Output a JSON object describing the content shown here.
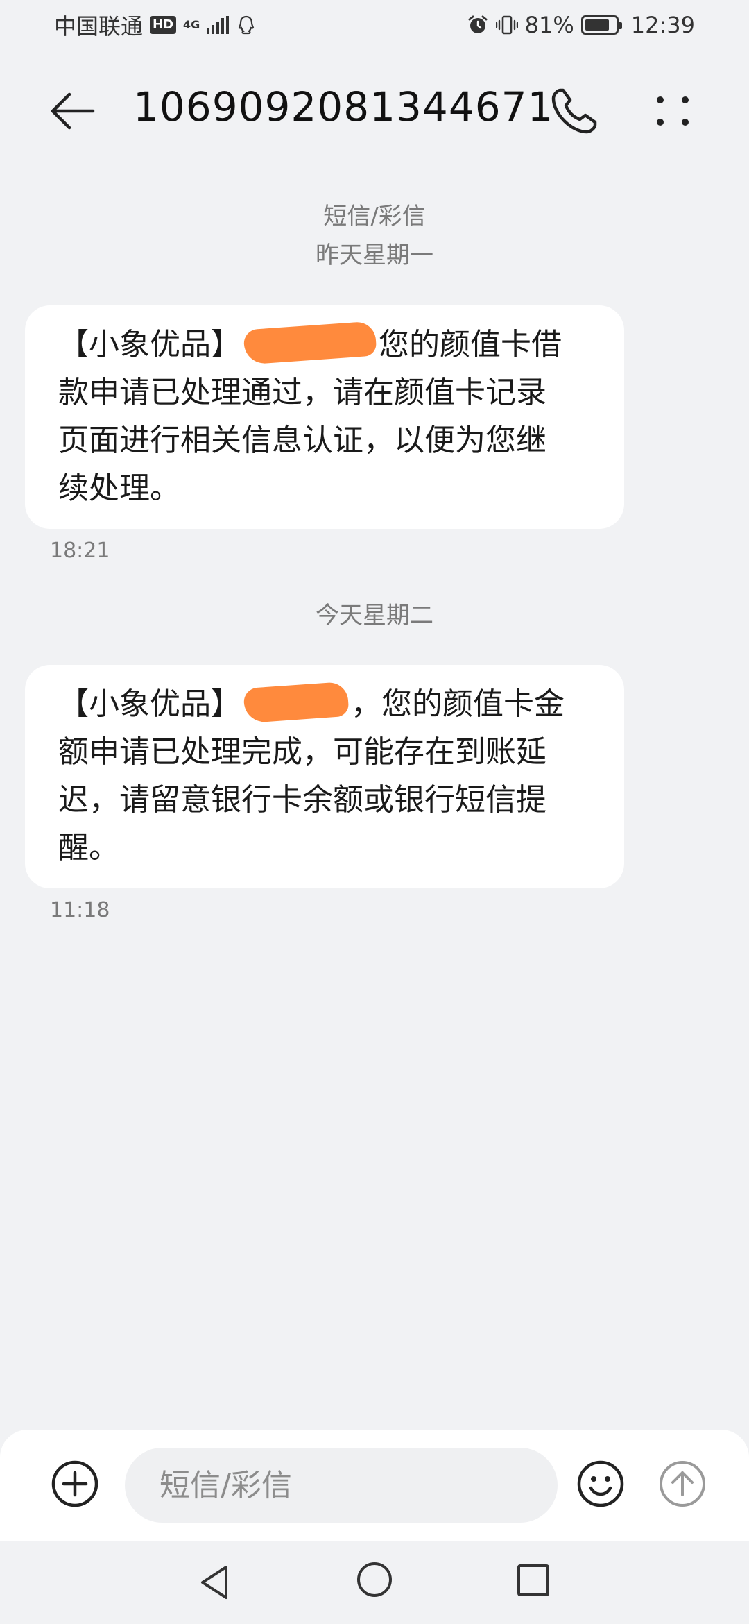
{
  "status_bar": {
    "carrier": "中国联通",
    "hd": "HD",
    "network": "4G",
    "battery_percent": "81%",
    "battery_level": 0.81,
    "time": "12:39"
  },
  "header": {
    "title": "1069092081344671"
  },
  "conversation": {
    "type_label": "短信/彩信",
    "groups": [
      {
        "date": "昨天星期一",
        "message": {
          "prefix": "【小象优品】",
          "line1_tail": "您的颜值卡借",
          "line2": "款申请已处理通过，请在颜值卡记录",
          "line3": "页面进行相关信息认证，以便为您继",
          "line4": "续处理。",
          "time": "18:21"
        }
      },
      {
        "date": "今天星期二",
        "message": {
          "prefix": "【小象优品】",
          "line1_tail": "，您的颜值卡金",
          "line2": "额申请已处理完成，可能存在到账延",
          "line3": "迟，请留意银行卡余额或银行短信提",
          "line4": "醒。",
          "time": "11:18"
        }
      }
    ]
  },
  "input_bar": {
    "placeholder": "短信/彩信"
  },
  "colors": {
    "background": "#f1f2f4",
    "bubble": "#ffffff",
    "redaction": "#ff8a3d",
    "secondary_text": "#7a7a7a"
  }
}
